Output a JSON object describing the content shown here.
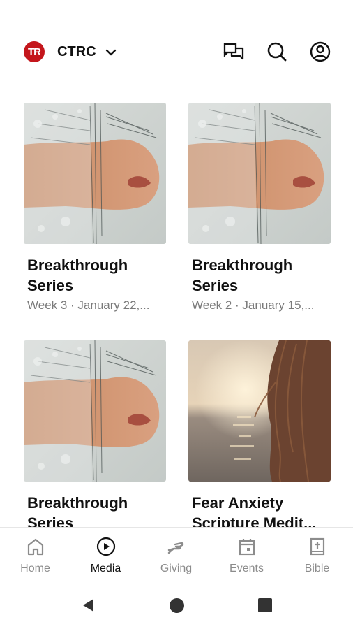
{
  "header": {
    "logo_text": "TR",
    "church_name": "CTRC",
    "icons": [
      "chevron-down-icon",
      "chat-icon",
      "search-icon",
      "account-icon"
    ]
  },
  "media": {
    "cards": [
      {
        "title_line1": "Breakthrough",
        "title_line2": "Series",
        "subtitle": "Week 3 · January 22,...",
        "image": "water-splash-face"
      },
      {
        "title_line1": "Breakthrough",
        "title_line2": "Series",
        "subtitle": "Week 2 · January 15,...",
        "image": "water-splash-face"
      },
      {
        "title_line1": "Breakthrough",
        "title_line2": "Series",
        "subtitle": "",
        "image": "water-splash-face"
      },
      {
        "title_line1": "Fear Anxiety",
        "title_line2": "Scripture Medit...",
        "subtitle": "",
        "image": "sunset-sea-hair"
      }
    ]
  },
  "nav": {
    "items": [
      {
        "label": "Home",
        "icon": "home-icon"
      },
      {
        "label": "Media",
        "icon": "play-circle-icon"
      },
      {
        "label": "Giving",
        "icon": "hand-icon"
      },
      {
        "label": "Events",
        "icon": "calendar-icon"
      },
      {
        "label": "Bible",
        "icon": "bible-icon"
      }
    ],
    "active": "Media"
  },
  "colors": {
    "logo_red": "#c4161c",
    "text_primary": "#111111",
    "text_secondary": "#7a7a7a",
    "nav_inactive": "#8c8c8c"
  }
}
